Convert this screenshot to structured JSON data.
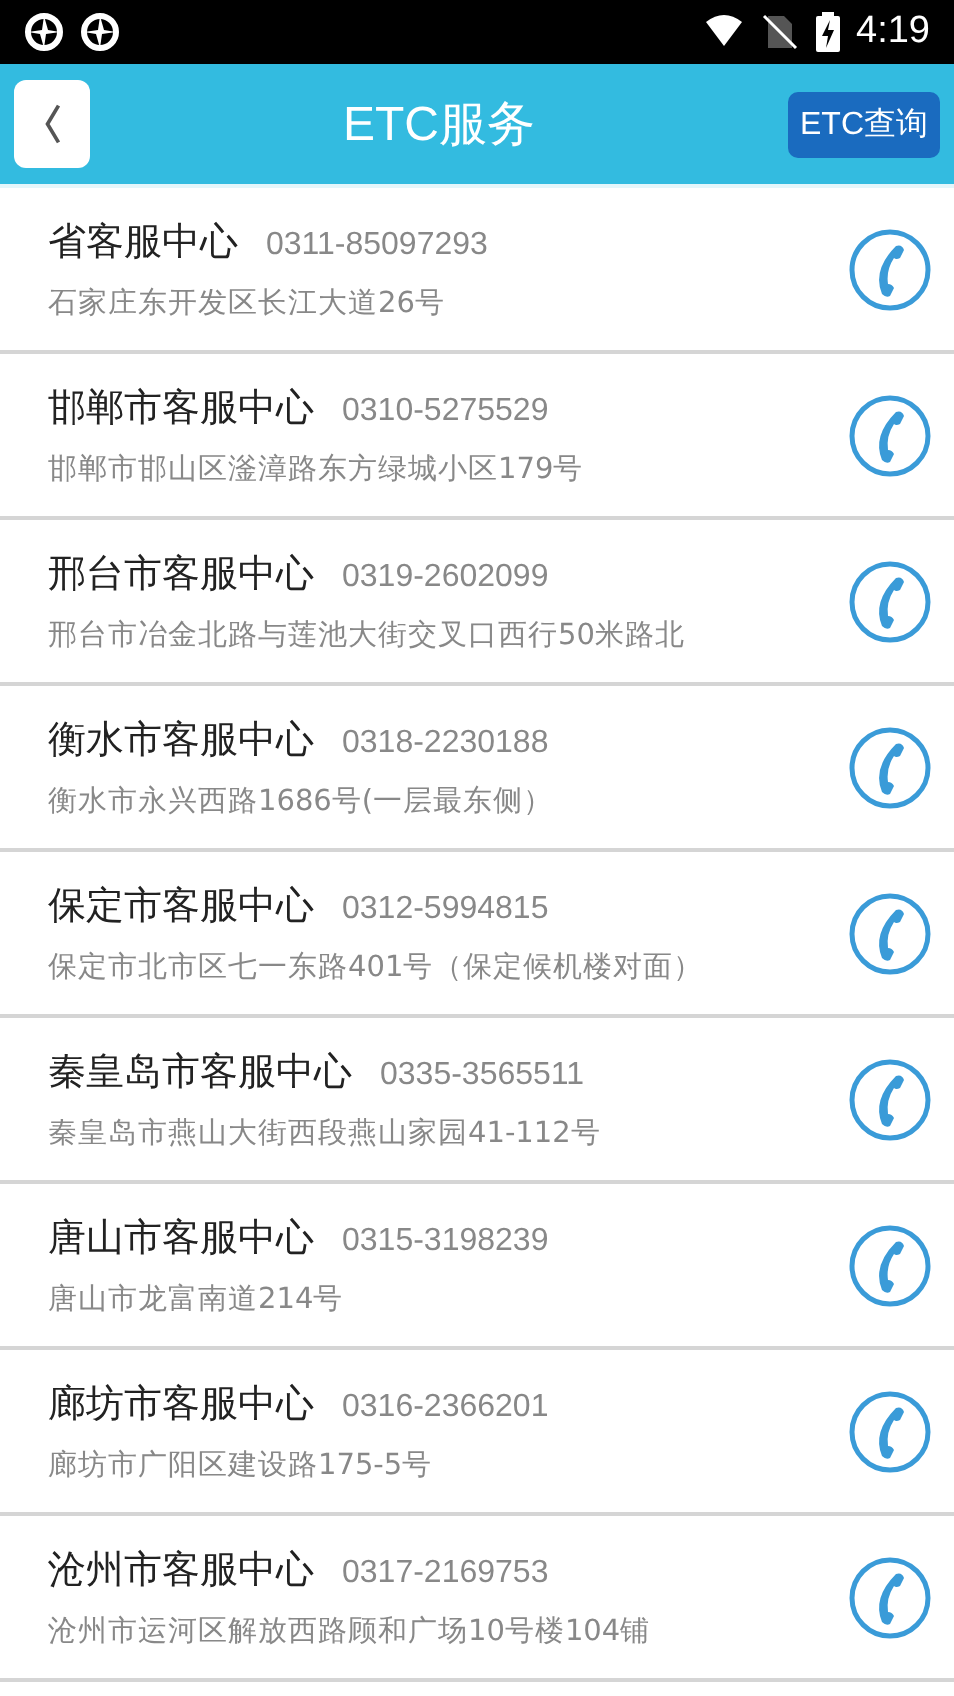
{
  "status_bar": {
    "time": "4:19"
  },
  "header": {
    "title": "ETC服务",
    "action": "ETC查询"
  },
  "centers": [
    {
      "name": "省客服中心",
      "phone": "0311-85097293",
      "address": "石家庄东开发区长江大道26号"
    },
    {
      "name": "邯郸市客服中心",
      "phone": "0310-5275529",
      "address": "邯郸市邯山区滏漳路东方绿城小区179号"
    },
    {
      "name": "邢台市客服中心",
      "phone": "0319-2602099",
      "address": "邢台市冶金北路与莲池大街交叉口西行50米路北"
    },
    {
      "name": "衡水市客服中心",
      "phone": "0318-2230188",
      "address": "衡水市永兴西路1686号(一层最东侧）"
    },
    {
      "name": "保定市客服中心",
      "phone": "0312-5994815",
      "address": "保定市北市区七一东路401号（保定候机楼对面）"
    },
    {
      "name": "秦皇岛市客服中心",
      "phone": "0335-3565511",
      "address": "秦皇岛市燕山大街西段燕山家园41-112号"
    },
    {
      "name": "唐山市客服中心",
      "phone": "0315-3198239",
      "address": "唐山市龙富南道214号"
    },
    {
      "name": "廊坊市客服中心",
      "phone": "0316-2366201",
      "address": "廊坊市广阳区建设路175-5号"
    },
    {
      "name": "沧州市客服中心",
      "phone": "0317-2169753",
      "address": "沧州市运河区解放西路顾和广场10号楼104铺"
    }
  ]
}
